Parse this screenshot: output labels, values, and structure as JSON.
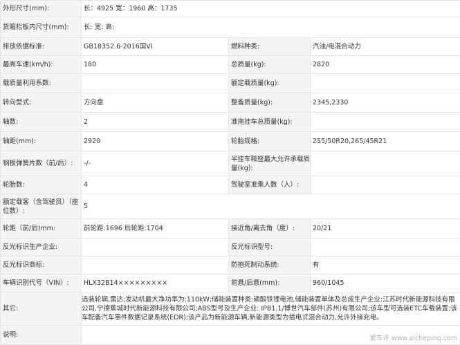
{
  "rows": {
    "dims": {
      "label": "外形尺寸(mm):",
      "value": "长：4925 宽：1960 高：1735"
    },
    "cargo": {
      "label": "货箱栏板内尺寸(mm):",
      "value": "长:  宽:  高:"
    },
    "r3": {
      "l1": "排放依据标准:",
      "v1": "GB18352.6-2016国VI",
      "l2": "燃料种类:",
      "v2": "汽油/电混合动力"
    },
    "r4": {
      "l1": "最高车速(km/h):",
      "v1": "180",
      "l2": "总质量(kg):",
      "v2": "2820"
    },
    "r5": {
      "l1": "载质量利用系数:",
      "v1": "",
      "l2": "额定载质量(kg):",
      "v2": ""
    },
    "r6": {
      "l1": "转向型式:",
      "v1": "方向盘",
      "l2": "整备质量(kg):",
      "v2": "2345,2330"
    },
    "r7": {
      "l1": "轴数:",
      "v1": "2",
      "l2": "准拖挂车总质量(kg):",
      "v2": ""
    },
    "r8": {
      "l1": "轴距(mm):",
      "v1": "2920",
      "l2": "轮胎规格:",
      "v2": "255/50R20,265/45R21"
    },
    "r9": {
      "l1": "钢板弹簧片数（前/后）:",
      "v1": "-/-",
      "l2": "半挂车鞍座最大允许承载质量(kg):",
      "v2": ""
    },
    "r10": {
      "l1": "轮胎数:",
      "v1": "4",
      "l2": "驾驶室准乘人数（人）:",
      "v2": ""
    },
    "r11": {
      "label": "额定载客（含驾驶员）（座位数）:",
      "value": "5"
    },
    "r12": {
      "l1": "轮距（前/后)mm:",
      "v1": "前轮距:1696 后轮距:1704",
      "l2": "接近角/离去角（度）:",
      "v2": "20/21"
    },
    "r13": {
      "l1": "反光标识生产企业:",
      "v1": "",
      "l2": "反光标识型号:",
      "v2": ""
    },
    "r14": {
      "l1": "反光标识商标:",
      "v1": "",
      "l2": "防抱死制动系统:",
      "v2": "有"
    },
    "r15": {
      "l1": "车辆识别代号（VIN）:",
      "v1": "HLX32B14×××××××××",
      "l2": "前悬/后悬(mm):",
      "v2": "960/1045"
    },
    "other": {
      "label": "其它:",
      "value": "选装轮辋,雷达;发动机最大净功率为:110kW;储能装置种类:磷酸铁锂电池,储能装置单体及总成生产企业:江苏时代新能源科技有限公司,宁德蕉城时代新能源科技有限公司;ABS型号及生产企业: IPB1.1/博世汽车部件(苏州)有限公司;该车型可选装ETC车载装置;该车配备汽车事件数据记录系统(EDR);该产品为新能源车辆,新能源类型为插电式混合动力,允许外接充电。"
    },
    "note": {
      "label": "说明:",
      "value": ""
    }
  },
  "watermark": "爱车评 www.aichepinq.com"
}
